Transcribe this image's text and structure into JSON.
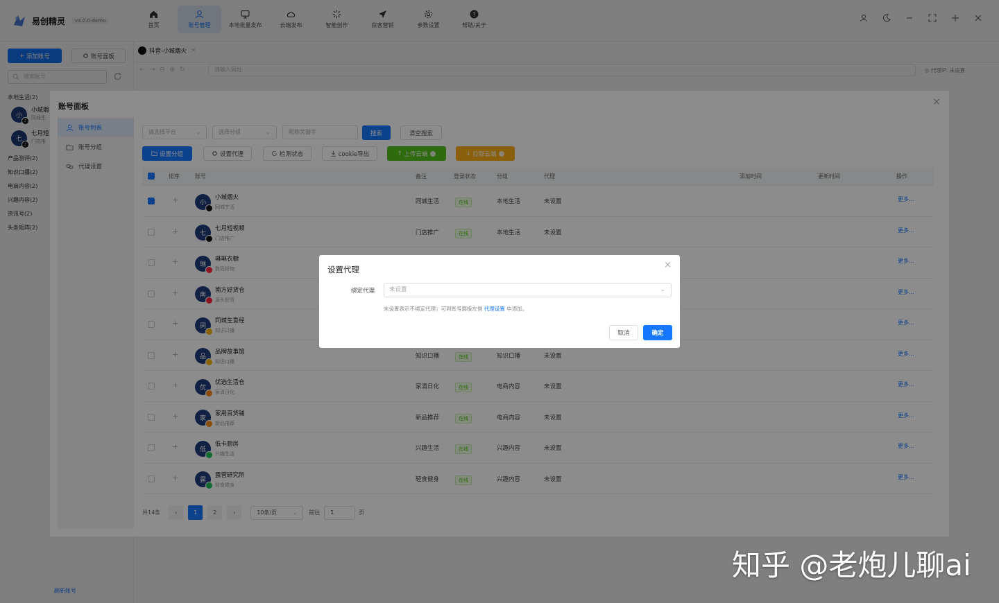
{
  "app": {
    "name": "易创精灵",
    "version": "v4.0.0-demo"
  },
  "nav": [
    {
      "label": "首页",
      "icon": "home-icon",
      "active": false
    },
    {
      "label": "账号管理",
      "icon": "user-icon",
      "active": true
    },
    {
      "label": "本地批量发布",
      "icon": "monitor-icon",
      "active": false
    },
    {
      "label": "云端发布",
      "icon": "cloud-icon",
      "active": false
    },
    {
      "label": "智能创作",
      "icon": "sparkle-icon",
      "active": false
    },
    {
      "label": "获客营销",
      "icon": "send-icon",
      "active": false
    },
    {
      "label": "参数设置",
      "icon": "gear-icon",
      "active": false
    },
    {
      "label": "帮助/关于",
      "icon": "help-icon",
      "active": false
    }
  ],
  "sidebar": {
    "add_label": "添加账号",
    "panel_label": "账号面板",
    "search_placeholder": "搜索账号",
    "groups": [
      {
        "label": "本地生活(2)"
      },
      {
        "label": "产品测评(2)"
      },
      {
        "label": "知识口播(2)"
      },
      {
        "label": "电商内容(2)"
      },
      {
        "label": "兴趣内容(2)"
      },
      {
        "label": "资讯号(2)"
      },
      {
        "label": "头条矩阵(2)"
      }
    ],
    "accounts": [
      {
        "initial": "小",
        "name": "小城烟",
        "sub": "同城生"
      },
      {
        "initial": "七",
        "name": "七月短",
        "sub": "门店推"
      }
    ],
    "bottom_link": "刷新账号"
  },
  "tab": {
    "label": "抖音-小城烟火",
    "close": "×"
  },
  "urlbar": {
    "placeholder": "请输入网址",
    "proxy_label": "代理IP: 未设置"
  },
  "panel": {
    "title": "账号面板",
    "menu": [
      {
        "label": "账号列表",
        "icon": "user-icon",
        "active": true
      },
      {
        "label": "账号分组",
        "icon": "folder-icon",
        "active": false
      },
      {
        "label": "代理设置",
        "icon": "link-icon",
        "active": false
      }
    ],
    "filters": {
      "platform_placeholder": "请选择平台",
      "group_placeholder": "选择分组",
      "keyword_placeholder": "昵称关键字",
      "search_label": "搜索",
      "clear_label": "清空搜索"
    },
    "toolbar": {
      "set_group": "设置分组",
      "set_proxy": "设置代理",
      "check_status": "检测状态",
      "cookie_export": "cookie导出",
      "upload_cloud": "上传云端",
      "pull_cloud": "拉取云端"
    },
    "columns": {
      "sort": "排序",
      "account": "账号",
      "note": "备注",
      "login": "登录状态",
      "group": "分组",
      "proxy": "代理",
      "added": "添加时间",
      "updated": "更新时间",
      "ops": "操作"
    },
    "rows": [
      {
        "initial": "小",
        "badge": "dy",
        "name": "小城烟火",
        "sub": "同城生活",
        "note": "同城生活",
        "status": "在线",
        "group": "本地生活",
        "proxy": "未设置",
        "more": "更多...",
        "checked": true
      },
      {
        "initial": "七",
        "badge": "dy",
        "name": "七月短视频",
        "sub": "门店推广",
        "note": "门店推广",
        "status": "在线",
        "group": "本地生活",
        "proxy": "未设置",
        "more": "更多...",
        "checked": false
      },
      {
        "initial": "琳",
        "badge": "xhs",
        "name": "琳琳衣橱",
        "sub": "数码好物",
        "note": "",
        "status": "",
        "group": "",
        "proxy": "",
        "more": "更多...",
        "checked": false
      },
      {
        "initial": "南",
        "badge": "xhs",
        "name": "南方好货仓",
        "sub": "源头好货",
        "note": "",
        "status": "",
        "group": "",
        "proxy": "",
        "more": "更多...",
        "checked": false
      },
      {
        "initial": "同",
        "badge": "wx",
        "name": "同城生意经",
        "sub": "知识口播",
        "note": "",
        "status": "",
        "group": "",
        "proxy": "",
        "more": "更多...",
        "checked": false
      },
      {
        "initial": "品",
        "badge": "wx",
        "name": "品牌故事馆",
        "sub": "知识口播",
        "note": "知识口播",
        "status": "在线",
        "group": "知识口播",
        "proxy": "未设置",
        "more": "更多...",
        "checked": false
      },
      {
        "initial": "优",
        "badge": "sph",
        "name": "优选生活仓",
        "sub": "家清日化",
        "note": "家清日化",
        "status": "在线",
        "group": "电商内容",
        "proxy": "未设置",
        "more": "更多...",
        "checked": false
      },
      {
        "initial": "家",
        "badge": "sph",
        "name": "家用百货铺",
        "sub": "新品推荐",
        "note": "新品推荐",
        "status": "在线",
        "group": "电商内容",
        "proxy": "未设置",
        "more": "更多...",
        "checked": false
      },
      {
        "initial": "低",
        "badge": "bl",
        "name": "低卡厨房",
        "sub": "兴趣生活",
        "note": "兴趣生活",
        "status": "在线",
        "group": "兴趣内容",
        "proxy": "未设置",
        "more": "更多...",
        "checked": false
      },
      {
        "initial": "露",
        "badge": "bl",
        "name": "露营研究所",
        "sub": "轻食健身",
        "note": "轻食健身",
        "status": "在线",
        "group": "兴趣内容",
        "proxy": "未设置",
        "more": "更多...",
        "checked": false
      }
    ],
    "pagination": {
      "total": "共14条",
      "prev": "‹",
      "pages": [
        "1",
        "2"
      ],
      "next": "›",
      "page_size": "10条/页",
      "goto_label": "前往",
      "goto_value": "1",
      "page_unit": "页"
    }
  },
  "modal": {
    "title": "设置代理",
    "label": "绑定代理",
    "placeholder": "未设置",
    "hint_before": "未设置表示不绑定代理；可到账号面板左侧",
    "hint_link": "代理设置",
    "hint_after": "中添加。",
    "cancel": "取消",
    "ok": "确定"
  },
  "watermark": "知乎 @老炮儿聊ai",
  "colors": {
    "primary": "#1677ff",
    "success": "#52c41a",
    "warning": "#faad14"
  }
}
